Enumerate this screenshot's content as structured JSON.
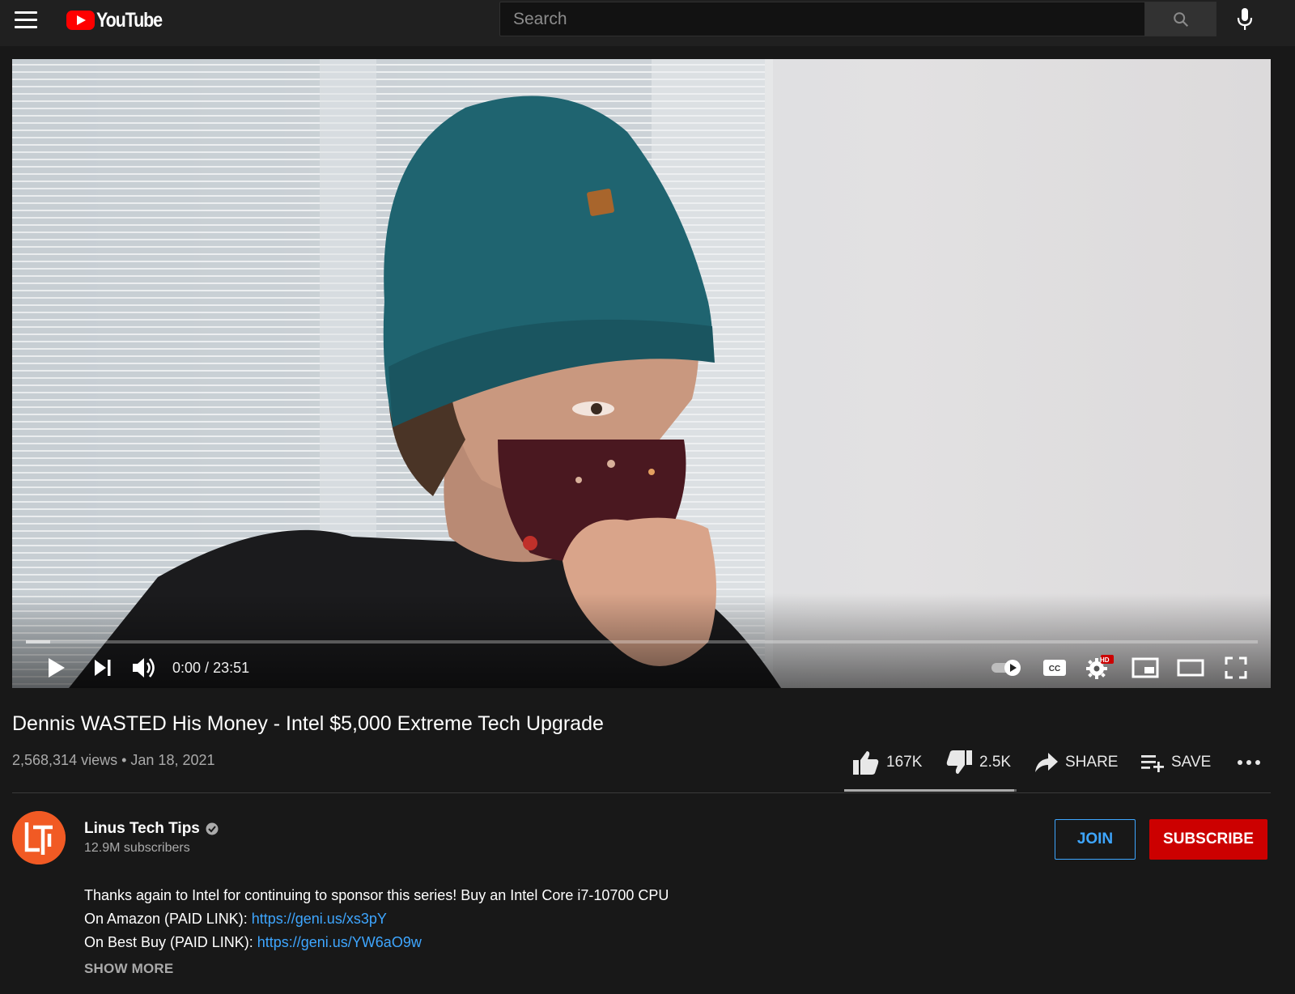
{
  "header": {
    "logo_text": "YouTube",
    "search_placeholder": "Search"
  },
  "player": {
    "time_current": "0:00",
    "time_separator": " / ",
    "time_total": "23:51",
    "progress_loaded_fraction": 0.02,
    "settings_badge": "HD"
  },
  "video": {
    "title": "Dennis WASTED His Money - Intel $5,000 Extreme Tech Upgrade",
    "views": "2,568,314 views",
    "meta_separator": " • ",
    "date": "Jan 18, 2021"
  },
  "actions": {
    "likes": "167K",
    "dislikes": "2.5K",
    "share_label": "SHARE",
    "save_label": "SAVE",
    "like_fraction": 0.985
  },
  "channel": {
    "name": "Linus Tech Tips",
    "subscribers": "12.9M subscribers",
    "join_label": "JOIN",
    "subscribe_label": "SUBSCRIBE"
  },
  "description": {
    "line1": "Thanks again to Intel for continuing to sponsor this series! Buy an Intel Core i7-10700 CPU",
    "line2_prefix": "On Amazon (PAID LINK): ",
    "line2_link": "https://geni.us/xs3pY",
    "line3_prefix": "On Best Buy (PAID LINK): ",
    "line3_link": "https://geni.us/YW6aO9w",
    "show_more": "SHOW MORE"
  },
  "colors": {
    "background": "#181818",
    "topbar": "#202020",
    "brand_red": "#ff0000",
    "subscribe_red": "#cc0000",
    "link_blue": "#3ea6ff",
    "channel_orange": "#f15a24"
  }
}
